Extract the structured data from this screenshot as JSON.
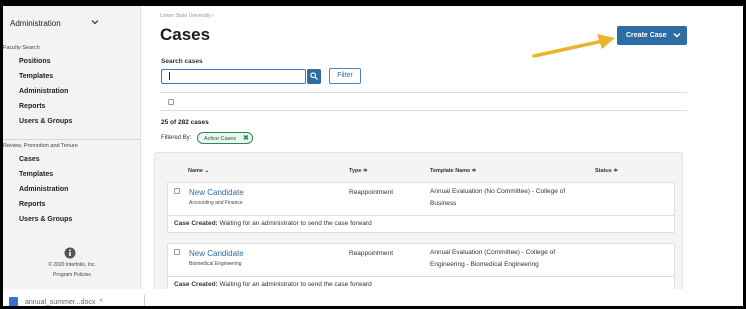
{
  "sidebar": {
    "top_select": "Administration",
    "faculty_search": {
      "heading": "Faculty Search",
      "items": [
        "Positions",
        "Templates",
        "Administration",
        "Reports",
        "Users & Groups"
      ]
    },
    "rpt": {
      "heading": "Review, Promotion and Tenure",
      "items": [
        "Cases",
        "Templates",
        "Administration",
        "Reports",
        "Users & Groups"
      ]
    },
    "copyright": "© 2020 Interfolio, Inc.",
    "policies": "Program Policies"
  },
  "main": {
    "breadcrumb": "Lorem State University  ›",
    "title": "Cases",
    "create_button": "Create Case",
    "search_label": "Search cases",
    "search_value": "",
    "search_placeholder": "",
    "filter_button": "Filter",
    "count": "25 of 282 cases",
    "filtered_by": "Filtered By:",
    "chip": "Active Cases",
    "chip_close": "✖"
  },
  "table": {
    "columns": {
      "name": "Name ⌄",
      "type": "Type ≑",
      "template": "Template Name ≑",
      "status": "Status ≑"
    },
    "rows": [
      {
        "candidate": "New Candidate",
        "unit": "Accounting and Finance",
        "type": "Reappointment",
        "template_line1": "Annual Evaluation (No Committee) - College of",
        "template_line2": "Business",
        "note_label": "Case Created:",
        "note_text": " Waiting for an administrator to send the case forward"
      },
      {
        "candidate": "New Candidate",
        "unit": "Biomedical Engineering",
        "type": "Reappointment",
        "template_line1": "Annual Evaluation (Committee) - College of",
        "template_line2": "Engineering - Biomedical Engineering",
        "note_label": "Case Created:",
        "note_text": " Waiting for an administrator to send the case forward"
      }
    ]
  },
  "download": {
    "file": "annual_summer...docx",
    "menu": "^"
  },
  "colors": {
    "accent": "#2d6da3",
    "chip_green": "#2f8a5a",
    "arrow": "#e9b530"
  },
  "icons": [
    "chevron-down-icon",
    "info-circle-icon",
    "search-icon",
    "arrow-icon",
    "close-icon",
    "document-icon"
  ]
}
